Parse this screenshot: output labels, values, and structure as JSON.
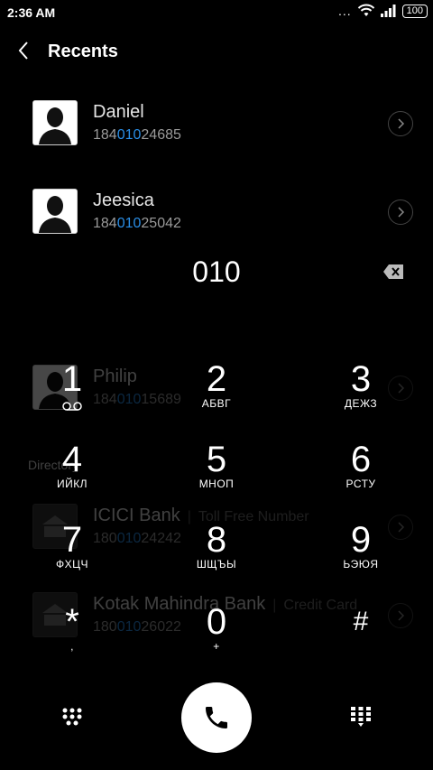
{
  "status_bar": {
    "time": "2:36 AM",
    "more": "...",
    "battery": "100"
  },
  "header": {
    "title": "Recents"
  },
  "recents": [
    {
      "name": "Daniel",
      "number_pre": "184",
      "number_hl": "010",
      "number_post": "24685"
    },
    {
      "name": "Jeesica",
      "number_pre": "184",
      "number_hl": "010",
      "number_post": "25042"
    }
  ],
  "dialed_number": "010",
  "background_list": {
    "contacts": [
      {
        "name": "Philip",
        "number_pre": "184",
        "number_hl": "010",
        "number_post": "15689"
      }
    ],
    "section_label": "Directory",
    "directory": [
      {
        "name": "ICICI Bank",
        "company": "Toll Free Number",
        "number_pre": "180",
        "number_hl": "010",
        "number_post": "24242"
      },
      {
        "name": "Kotak Mahindra Bank",
        "company": "Credit Card",
        "number_pre": "180",
        "number_hl": "010",
        "number_post": "26022"
      }
    ]
  },
  "keypad": [
    {
      "digit": "1",
      "letters": ""
    },
    {
      "digit": "2",
      "letters": "АБВГ"
    },
    {
      "digit": "3",
      "letters": "ДЕЖЗ"
    },
    {
      "digit": "4",
      "letters": "ИЙКЛ"
    },
    {
      "digit": "5",
      "letters": "МНОП"
    },
    {
      "digit": "6",
      "letters": "РСТУ"
    },
    {
      "digit": "7",
      "letters": "ФХЦЧ"
    },
    {
      "digit": "8",
      "letters": "ШЩЪЫ"
    },
    {
      "digit": "9",
      "letters": "ЬЭЮЯ"
    },
    {
      "digit": "*",
      "letters": ","
    },
    {
      "digit": "0",
      "letters": "+"
    },
    {
      "digit": "#",
      "letters": ""
    }
  ],
  "colors": {
    "highlight": "#2a8ee6",
    "background": "#000000"
  }
}
